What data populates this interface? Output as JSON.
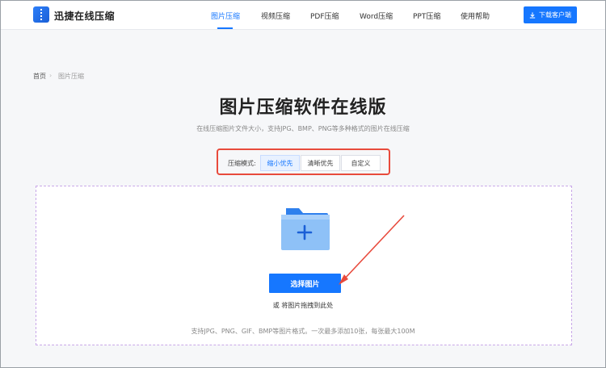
{
  "header": {
    "brand": "迅捷在线压缩",
    "nav": [
      "图片压缩",
      "视频压缩",
      "PDF压缩",
      "Word压缩",
      "PPT压缩",
      "使用帮助"
    ],
    "active_nav": "图片压缩",
    "download_label": "下载客户端",
    "accent": "#1677ff"
  },
  "breadcrumb": {
    "home": "首页",
    "current": "图片压缩"
  },
  "main": {
    "title": "图片压缩软件在线版",
    "subtitle": "在线压缩图片文件大小，支持JPG、BMP、PNG等多种格式的图片在线压缩",
    "mode": {
      "label": "压缩模式:",
      "options": [
        "缩小优先",
        "清晰优先",
        "自定义"
      ],
      "selected": "缩小优先",
      "highlight_color": "#e84a3c"
    },
    "upload": {
      "folder_icon": "folder-plus-icon",
      "button_label": "选择图片",
      "drag_hint": "或 将图片拖拽到此处",
      "formats_note": "支持JPG、PNG、GIF、BMP等图片格式。一次最多添加10张，每张最大100M"
    }
  }
}
